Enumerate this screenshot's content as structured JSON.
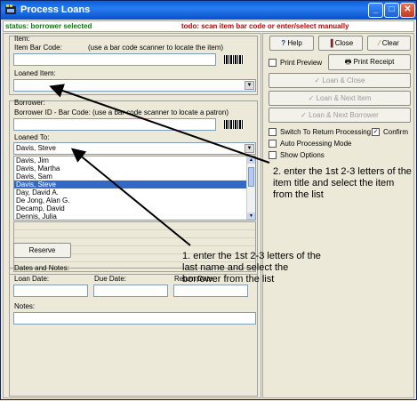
{
  "window": {
    "title": "Process Loans",
    "min": "_",
    "max": "□",
    "close": "✕"
  },
  "status": {
    "left": "status: borrower selected",
    "right": "todo: scan item bar code or enter/select manually"
  },
  "item": {
    "section_label": "Item:",
    "barcode_label": "Item Bar Code:",
    "barcode_hint": "(use a bar code scanner to locate the item)",
    "barcode_value": "",
    "loaned_item_label": "Loaned Item:",
    "loaned_item_value": ""
  },
  "borrower": {
    "section_label": "Borrower:",
    "barcode_label": "Borrower ID - Bar Code:",
    "barcode_hint": "(use a bar code scanner to locate a patron)",
    "barcode_value": "",
    "loaned_to_label": "Loaned To:",
    "loaned_to_value": "Davis, Steve",
    "list": [
      "Davis, Jim",
      "Davis, Martha",
      "Davis, Sam",
      "Davis, Steve",
      "Day, David A.",
      "De Jong, Alan G.",
      "Decamp, David",
      "Dennis, Julia"
    ],
    "selected_index": 3
  },
  "reserve_label": "Reserve",
  "dates": {
    "section_label": "Dates and Notes:",
    "loan_date_label": "Loan Date:",
    "due_date_label": "Due Date:",
    "return_date_label": "Return Date:",
    "notes_label": "Notes:"
  },
  "toolbar": {
    "help": "Help",
    "close": "Close",
    "clear": "Clear",
    "print_preview": "Print Preview",
    "print_receipt": "Print Receipt",
    "loan_close": "Loan & Close",
    "loan_next_item": "Loan & Next Item",
    "loan_next_borrower": "Loan & Next Borrower"
  },
  "options": {
    "switch_return": "Switch To Return Processing",
    "confirm": "Confirm",
    "confirm_checked": true,
    "auto_processing": "Auto Processing Mode",
    "show_options": "Show Options"
  },
  "annotations": {
    "note1": "1. enter the 1st 2-3 letters of the last name and select the borrower from the list",
    "note2": "2. enter the 1st 2-3 letters of the item title and select the item from the list"
  },
  "colors": {
    "titlebar": "#0a5ed8",
    "status_ok": "#008000",
    "status_todo": "#cc0000",
    "selection": "#316ac5"
  }
}
